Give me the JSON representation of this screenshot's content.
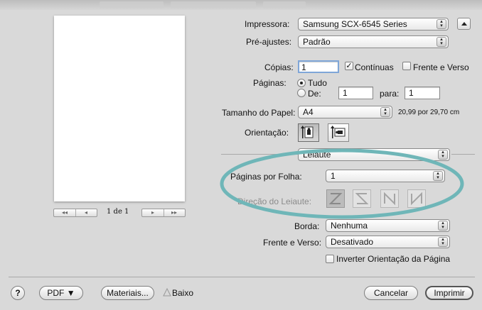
{
  "printer": {
    "label": "Impressora:",
    "value": "Samsung SCX-6545 Series"
  },
  "presets": {
    "label": "Pré-ajustes:",
    "value": "Padrão"
  },
  "copies": {
    "label": "Cópias:",
    "value": "1",
    "collated_label": "Contínuas",
    "collated_checked": true,
    "duplex_label": "Frente e Verso",
    "duplex_checked": false
  },
  "pages": {
    "label": "Páginas:",
    "all_label": "Tudo",
    "from_label": "De:",
    "from_value": "1",
    "to_label": "para:",
    "to_value": "1",
    "selected": "all"
  },
  "paper_size": {
    "label": "Tamanho do Papel:",
    "value": "A4",
    "dimensions": "20,99 por 29,70 cm"
  },
  "orientation": {
    "label": "Orientação:"
  },
  "section_menu": {
    "value": "Leiaute"
  },
  "pages_per_sheet": {
    "label": "Páginas por Folha:",
    "value": "1"
  },
  "layout_direction": {
    "label": "Direção do Leiaute:"
  },
  "border": {
    "label": "Borda:",
    "value": "Nenhuma"
  },
  "two_sided": {
    "label": "Frente e Verso:",
    "value": "Desativado"
  },
  "reverse_orientation": {
    "label": "Inverter Orientação da Página",
    "checked": false
  },
  "preview_nav": {
    "page_text": "1 de 1"
  },
  "bottom": {
    "help": "?",
    "pdf": "PDF ▼",
    "supplies": "Materiais...",
    "warning_text": "Baixo",
    "cancel": "Cancelar",
    "print": "Imprimir"
  },
  "annotation": {
    "color": "#6fb6b8"
  }
}
